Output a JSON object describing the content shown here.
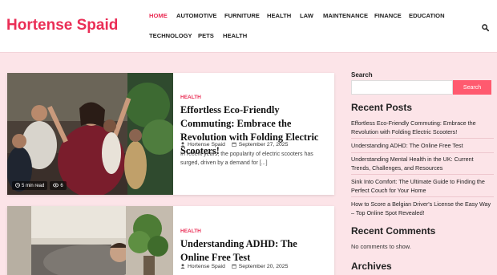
{
  "header": {
    "site_title": "Hortense Spaid",
    "nav": [
      {
        "label": "HOME",
        "active": true
      },
      {
        "label": "AUTOMOTIVE"
      },
      {
        "label": "FURNITURE"
      },
      {
        "label": "HEALTH"
      },
      {
        "label": "LAW"
      },
      {
        "label": "MAINTENANCE"
      },
      {
        "label": "FINANCE"
      },
      {
        "label": "EDUCATION"
      },
      {
        "label": "TECHNOLOGY"
      },
      {
        "label": "PETS"
      },
      {
        "label": "HEALTH"
      }
    ],
    "search_icon": "search-icon"
  },
  "posts": [
    {
      "category": "HEALTH",
      "title": "Effortless Eco-Friendly Commuting: Embrace the Revolution with Folding Electric Scooters!",
      "author": "Hortense Spaid",
      "date": "September 27, 2025",
      "excerpt": "In recent years, the popularity of electric scooters has surged, driven by a demand for [...]",
      "read_time": "5 min read",
      "views": "6"
    },
    {
      "category": "HEALTH",
      "title": "Understanding ADHD: The Online Free Test",
      "author": "Hortense Spaid",
      "date": "September 20, 2025"
    }
  ],
  "sidebar": {
    "search_label": "Search",
    "search_placeholder": "",
    "search_button": "Search",
    "recent_posts_title": "Recent Posts",
    "recent_posts": [
      "Effortless Eco-Friendly Commuting: Embrace the Revolution with Folding Electric Scooters!",
      "Understanding ADHD: The Online Free Test",
      "Understanding Mental Health in the UK: Current Trends, Challenges, and Resources",
      "Sink Into Comfort: The Ultimate Guide to Finding the Perfect Couch for Your Home",
      "How to Score a Belgian Driver's License the Easy Way – Top Online Spot Revealed!"
    ],
    "recent_comments_title": "Recent Comments",
    "no_comments": "No comments to show.",
    "archives_title": "Archives"
  },
  "colors": {
    "accent": "#ea2e56",
    "button": "#ff5a6f",
    "background": "#fce4e8"
  }
}
